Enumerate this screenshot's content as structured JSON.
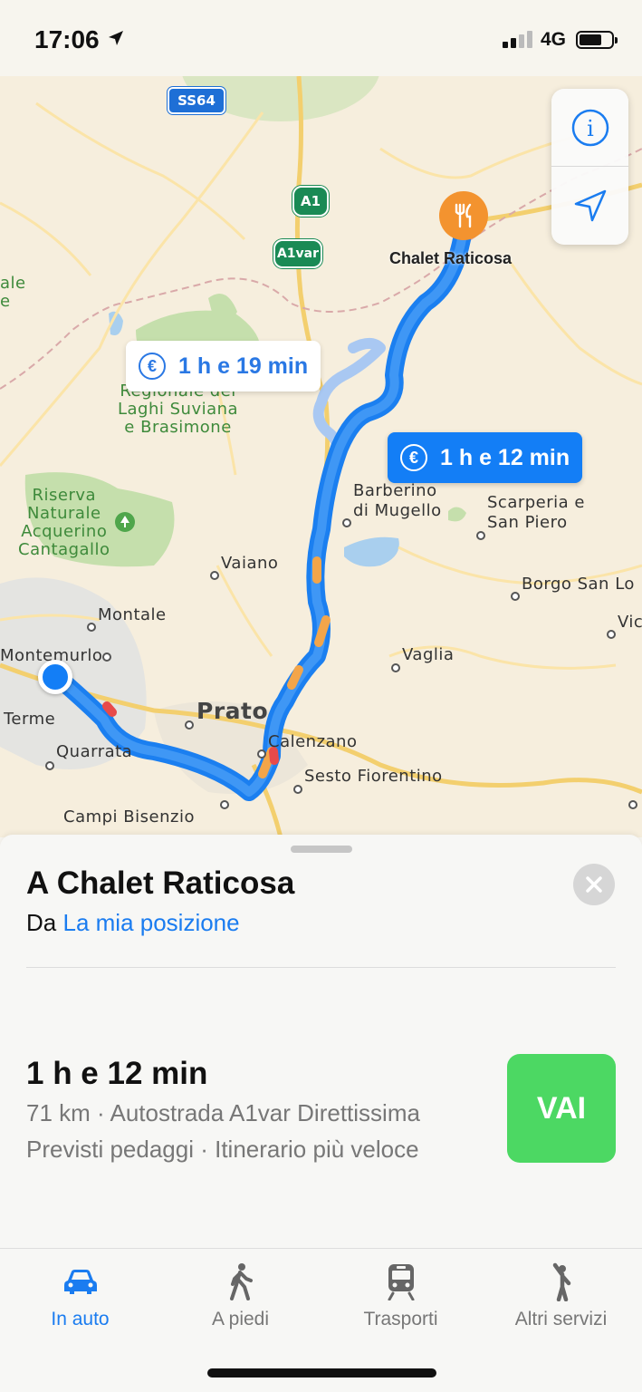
{
  "status_bar": {
    "time": "17:06",
    "network": "4G"
  },
  "map": {
    "road_shields": {
      "ss": "SS64",
      "a1": "A1",
      "a1var": "A1var"
    },
    "destination_label": "Chalet Raticosa",
    "routes": {
      "alternative_time": "1 h e 19 min",
      "primary_time": "1 h e 12 min",
      "toll_symbol": "€"
    },
    "places": {
      "park1": [
        "Regionale dei",
        "Laghi Suviana",
        "e Brasimone"
      ],
      "park2": [
        "Riserva",
        "Naturale",
        "Acquerino",
        "Cantagallo"
      ],
      "edge_left": [
        "ale",
        "e"
      ],
      "barberino": [
        "Barberino",
        "di Mugello"
      ],
      "scarperia": [
        "Scarperia e",
        "San Piero"
      ],
      "vaiano": "Vaiano",
      "borgo": "Borgo San Lo",
      "vic": "Vic",
      "montale": "Montale",
      "montemurlo": "Montemurlo",
      "vaglia": "Vaglia",
      "prato": "Prato",
      "terme": "Terme",
      "quarrata": "Quarrata",
      "calenzano": "Calenzano",
      "sesto": "Sesto Fiorentino",
      "campi": "Campi Bisenzio"
    }
  },
  "sheet": {
    "title": "A Chalet Raticosa",
    "from_prefix": "Da",
    "from_link": "La mia posizione",
    "duration": "1 h e 12 min",
    "detail_line1": "71 km · Autostrada A1var Direttissima",
    "detail_line2": "Previsti pedaggi · Itinerario più veloce",
    "go_label": "VAI"
  },
  "tabs": [
    {
      "label": "In auto",
      "icon": "car-icon",
      "active": true
    },
    {
      "label": "A piedi",
      "icon": "walking-icon",
      "active": false
    },
    {
      "label": "Trasporti",
      "icon": "train-icon",
      "active": false
    },
    {
      "label": "Altri servizi",
      "icon": "hailing-person-icon",
      "active": false
    }
  ],
  "colors": {
    "accent": "#137ef6",
    "go": "#4cd863",
    "pin": "#f3932f"
  }
}
